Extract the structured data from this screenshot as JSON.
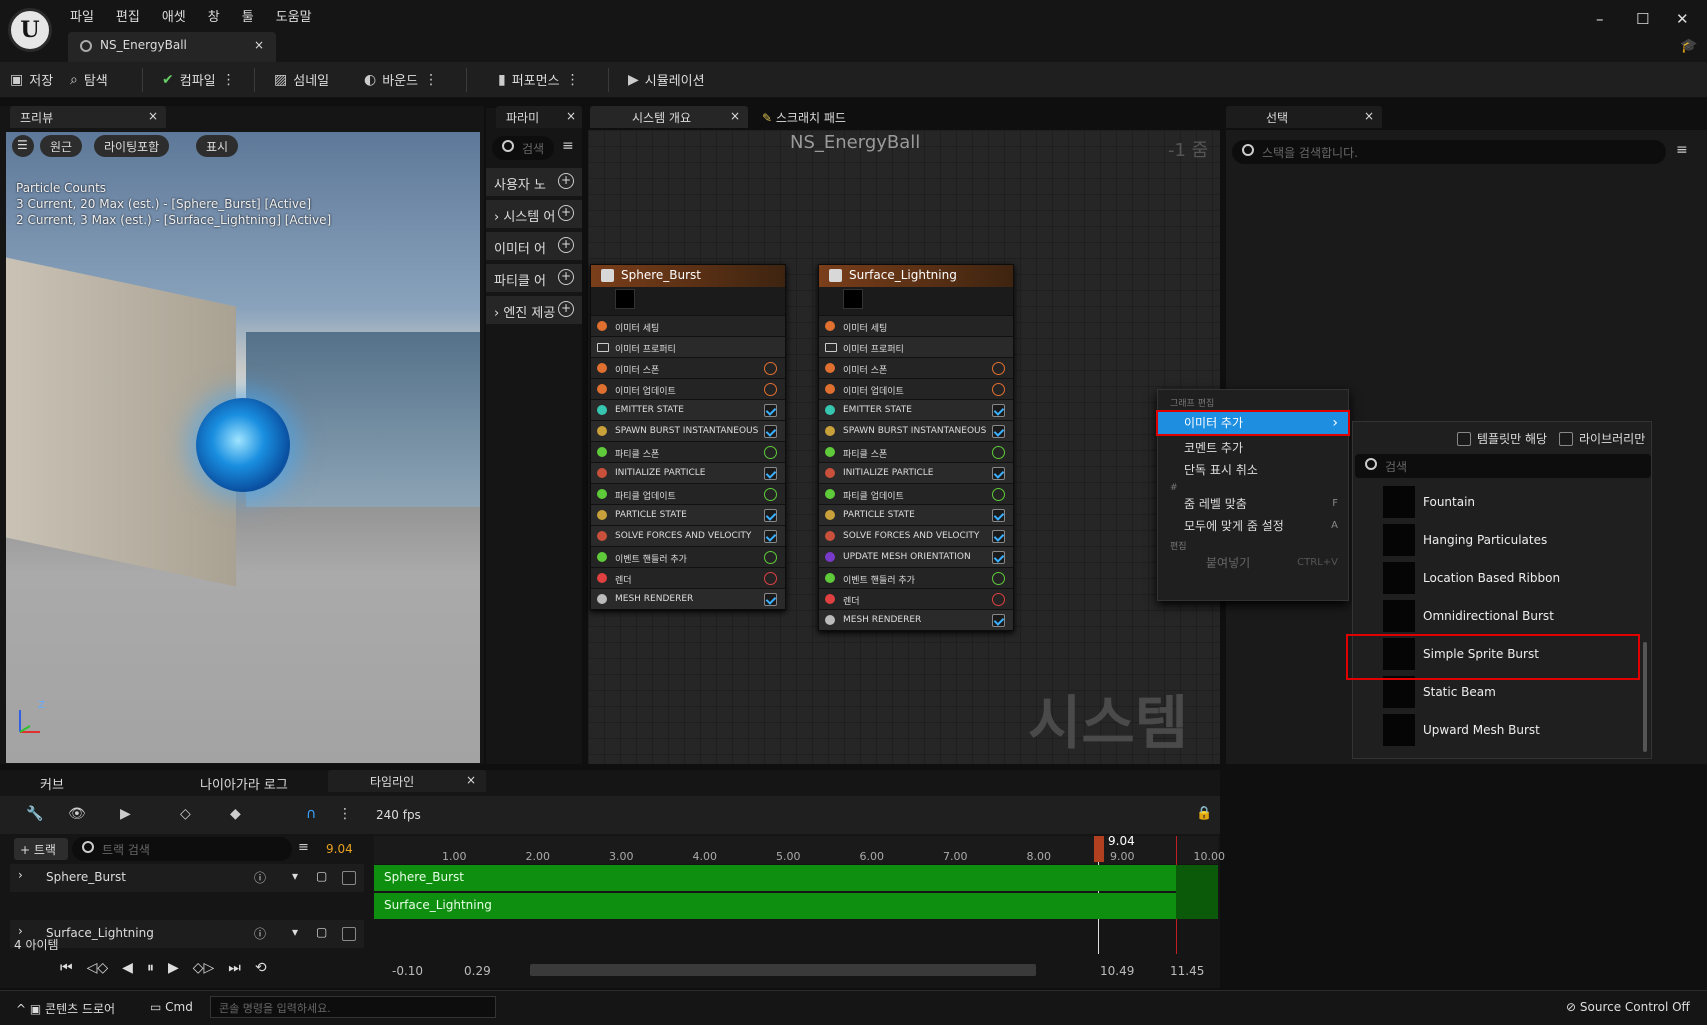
{
  "app": {
    "menu": [
      "파일",
      "편집",
      "애셋",
      "창",
      "툴",
      "도움말"
    ],
    "doc_tab": "NS_EnergyBall",
    "close": "×"
  },
  "window_controls": {
    "minimize": "–",
    "maximize": "☐",
    "close": "✕"
  },
  "toolbar": {
    "save": "저장",
    "browse": "탐색",
    "compile": "컴파일",
    "thumbnail": "섬네일",
    "bounds": "바운드",
    "performance": "퍼포먼스",
    "simulation": "시뮬레이션"
  },
  "preview": {
    "tab": "프리뷰",
    "perspective": "원근",
    "lighting": "라이팅포함",
    "show": "표시",
    "overlay": [
      "Particle Counts",
      "3 Current, 20 Max (est.) - [Sphere_Burst] [Active]",
      "2 Current, 3 Max (est.) - [Surface_Lightning] [Active]"
    ],
    "axis_z": "Z"
  },
  "params": {
    "tab": "파라미",
    "search_placeholder": "검색",
    "categories": [
      "사용자 노",
      "시스템 어",
      "이미터 어",
      "파티클 어",
      "엔진 제공"
    ]
  },
  "graph": {
    "tabs": [
      "시스템 개요",
      "스크래치 패드"
    ],
    "title": "NS_EnergyBall",
    "zoom": "-1 줌",
    "watermark": "시스템",
    "nodes": [
      {
        "name": "Sphere_Burst",
        "rows": [
          {
            "label": "이미터 세팅",
            "kind": "sect",
            "color": "#e07030"
          },
          {
            "label": "이미터 프로퍼티",
            "kind": "cpu",
            "color": ""
          },
          {
            "label": "이미터 스폰",
            "kind": "add",
            "color": "#e07030"
          },
          {
            "label": "이미터 업데이트",
            "kind": "add",
            "color": "#e07030"
          },
          {
            "label": "EMITTER STATE",
            "kind": "check",
            "color": "#37c7b0"
          },
          {
            "label": "SPAWN BURST INSTANTANEOUS",
            "kind": "check",
            "color": "#c9a13a"
          },
          {
            "label": "파티클 스폰",
            "kind": "add",
            "color": "#5fcb3a"
          },
          {
            "label": "INITIALIZE PARTICLE",
            "kind": "check",
            "color": "#c9503a"
          },
          {
            "label": "파티클 업데이트",
            "kind": "add",
            "color": "#5fcb3a"
          },
          {
            "label": "PARTICLE STATE",
            "kind": "check",
            "color": "#c9a13a"
          },
          {
            "label": "SOLVE FORCES AND VELOCITY",
            "kind": "check",
            "color": "#c9503a"
          },
          {
            "label": "이벤트 핸들러 추가",
            "kind": "add",
            "color": "#5fcb3a"
          },
          {
            "label": "렌더",
            "kind": "add",
            "color": "#e04040"
          },
          {
            "label": "MESH RENDERER",
            "kind": "check",
            "color": "#bbbbbb"
          }
        ]
      },
      {
        "name": "Surface_Lightning",
        "rows": [
          {
            "label": "이미터 세팅",
            "kind": "sect",
            "color": "#e07030"
          },
          {
            "label": "이미터 프로퍼티",
            "kind": "cpu",
            "color": ""
          },
          {
            "label": "이미터 스폰",
            "kind": "add",
            "color": "#e07030"
          },
          {
            "label": "이미터 업데이트",
            "kind": "add",
            "color": "#e07030"
          },
          {
            "label": "EMITTER STATE",
            "kind": "check",
            "color": "#37c7b0"
          },
          {
            "label": "SPAWN BURST INSTANTANEOUS",
            "kind": "check",
            "color": "#c9a13a"
          },
          {
            "label": "파티클 스폰",
            "kind": "add",
            "color": "#5fcb3a"
          },
          {
            "label": "INITIALIZE PARTICLE",
            "kind": "check",
            "color": "#c9503a"
          },
          {
            "label": "파티클 업데이트",
            "kind": "add",
            "color": "#5fcb3a"
          },
          {
            "label": "PARTICLE STATE",
            "kind": "check",
            "color": "#c9a13a"
          },
          {
            "label": "SOLVE FORCES AND VELOCITY",
            "kind": "check",
            "color": "#c9503a"
          },
          {
            "label": "UPDATE MESH ORIENTATION",
            "kind": "check",
            "color": "#7a3ac9"
          },
          {
            "label": "이벤트 핸들러 추가",
            "kind": "add",
            "color": "#5fcb3a"
          },
          {
            "label": "렌더",
            "kind": "add",
            "color": "#e04040"
          },
          {
            "label": "MESH RENDERER",
            "kind": "check",
            "color": "#bbbbbb"
          }
        ]
      }
    ]
  },
  "selection": {
    "tab": "선택",
    "search_placeholder": "스택을 검색합니다."
  },
  "context_menu": {
    "h_graph_edit": "그래프 편집",
    "add_emitter": "이미터 추가",
    "add_comment": "코멘트 추가",
    "unsolo": "단독 표시 취소",
    "h_hash": "#",
    "zoom_fit": "줌 레벨 맞춤",
    "zoom_fit_key": "F",
    "zoom_all": "모두에 맞게 줌 설정",
    "zoom_all_key": "A",
    "h_edit": "편집",
    "paste": "붙여넣기",
    "paste_key": "CTRL+V"
  },
  "submenu": {
    "templates_only": "템플릿만 해당",
    "library_only": "라이브러리만",
    "search_placeholder": "검색",
    "items": [
      "Fountain",
      "Hanging Particulates",
      "Location Based Ribbon",
      "Omnidirectional Burst",
      "Simple Sprite Burst",
      "Static Beam",
      "Upward Mesh Burst"
    ],
    "highlighted": "Simple Sprite Burst"
  },
  "bottom": {
    "tabs": [
      "커브",
      "나이아가라 로그",
      "타임라인"
    ],
    "fps": "240 fps",
    "track_button": "+ 트랙",
    "track_search": "트랙 검색",
    "current_time": "9.04",
    "ruler": [
      "1.00",
      "2.00",
      "3.00",
      "4.00",
      "5.00",
      "6.00",
      "7.00",
      "8.00",
      "9.00",
      "10.00"
    ],
    "tracks": [
      "Sphere_Burst",
      "Surface_Lightning"
    ],
    "item_count": "4 아이템",
    "range": [
      "-0.10",
      "0.29",
      "10.49",
      "11.45"
    ]
  },
  "status": {
    "content_drawer": "콘텐츠 드로어",
    "cmd": "Cmd",
    "cmd_placeholder": "콘솔 명령을 입력하세요.",
    "source_control": "Source Control Off"
  }
}
